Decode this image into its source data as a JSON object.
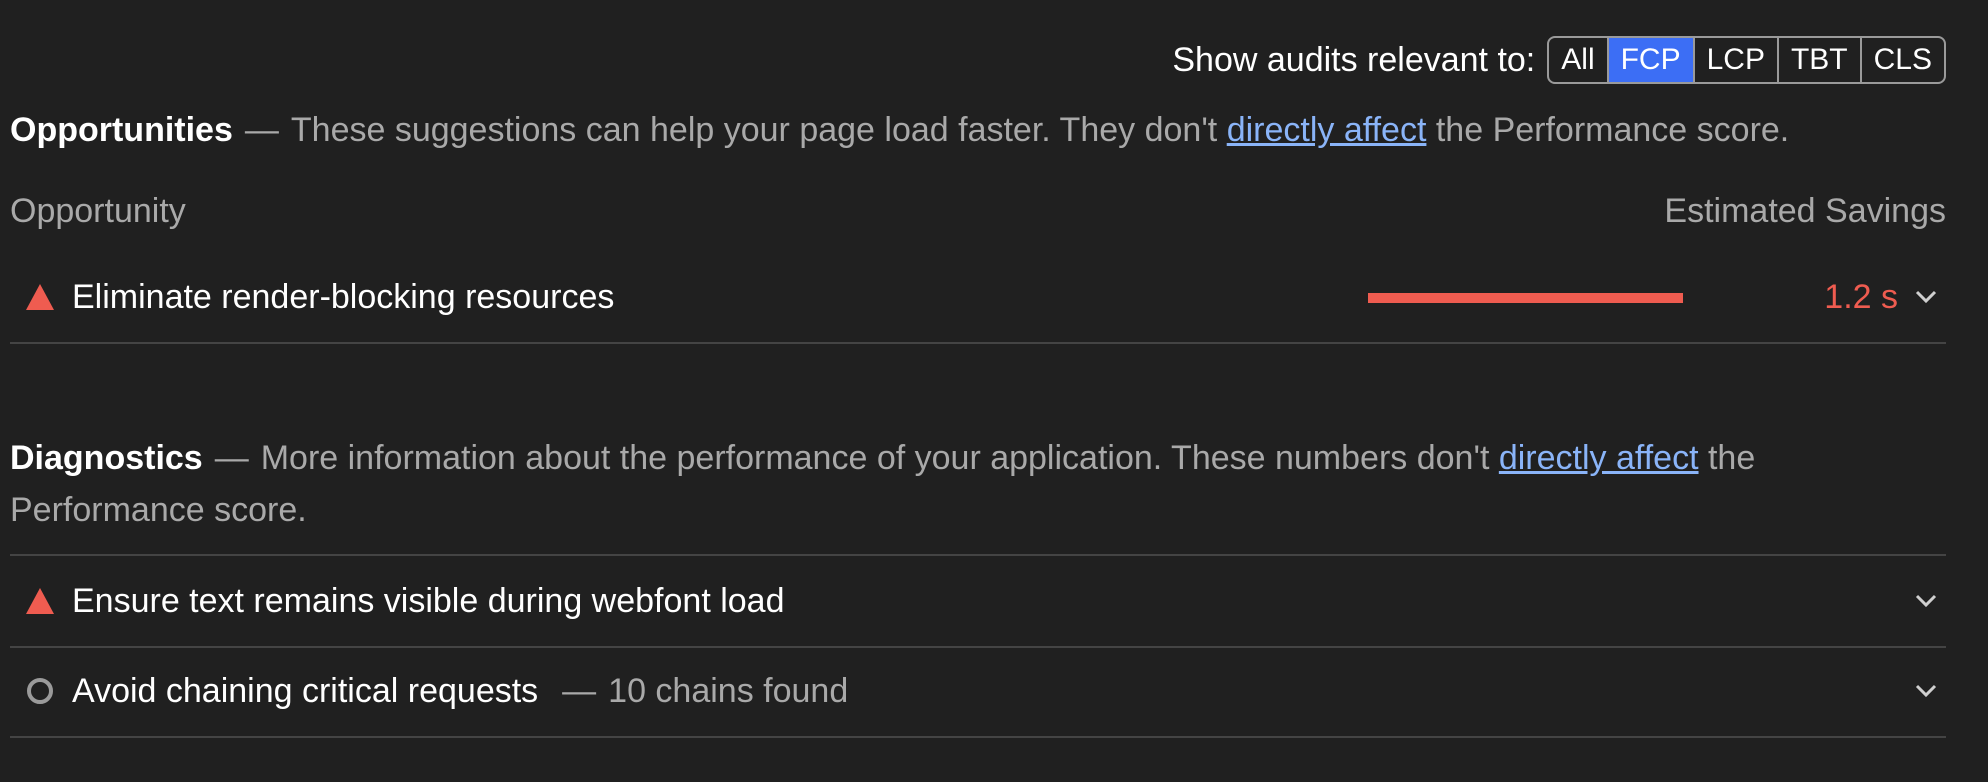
{
  "filter": {
    "label": "Show audits relevant to:",
    "options": [
      "All",
      "FCP",
      "LCP",
      "TBT",
      "CLS"
    ],
    "selected": "FCP"
  },
  "opportunities": {
    "title": "Opportunities",
    "dash": "—",
    "desc_before": "These suggestions can help your page load faster. They don't",
    "link": "directly affect",
    "desc_after": "the Performance score.",
    "col_opportunity": "Opportunity",
    "col_savings": "Estimated Savings",
    "items": [
      {
        "title": "Eliminate render-blocking resources",
        "savings": "1.2 s",
        "savings_fraction": 0.78,
        "status_icon": "fail-triangle-icon"
      }
    ]
  },
  "diagnostics": {
    "title": "Diagnostics",
    "dash": "—",
    "desc_before": "More information about the performance of your application. These numbers don't",
    "link": "directly affect",
    "desc_after": "the Performance score.",
    "items": [
      {
        "title": "Ensure text remains visible during webfont load",
        "status_icon": "fail-triangle-icon"
      },
      {
        "title": "Avoid chaining critical requests",
        "dash": "—",
        "detail": "10 chains found",
        "status_icon": "informative-circle-icon"
      }
    ]
  },
  "colors": {
    "background": "#202020",
    "fail": "#ef5c50",
    "accent": "#3c6ef5",
    "link": "#8ab4f8"
  }
}
